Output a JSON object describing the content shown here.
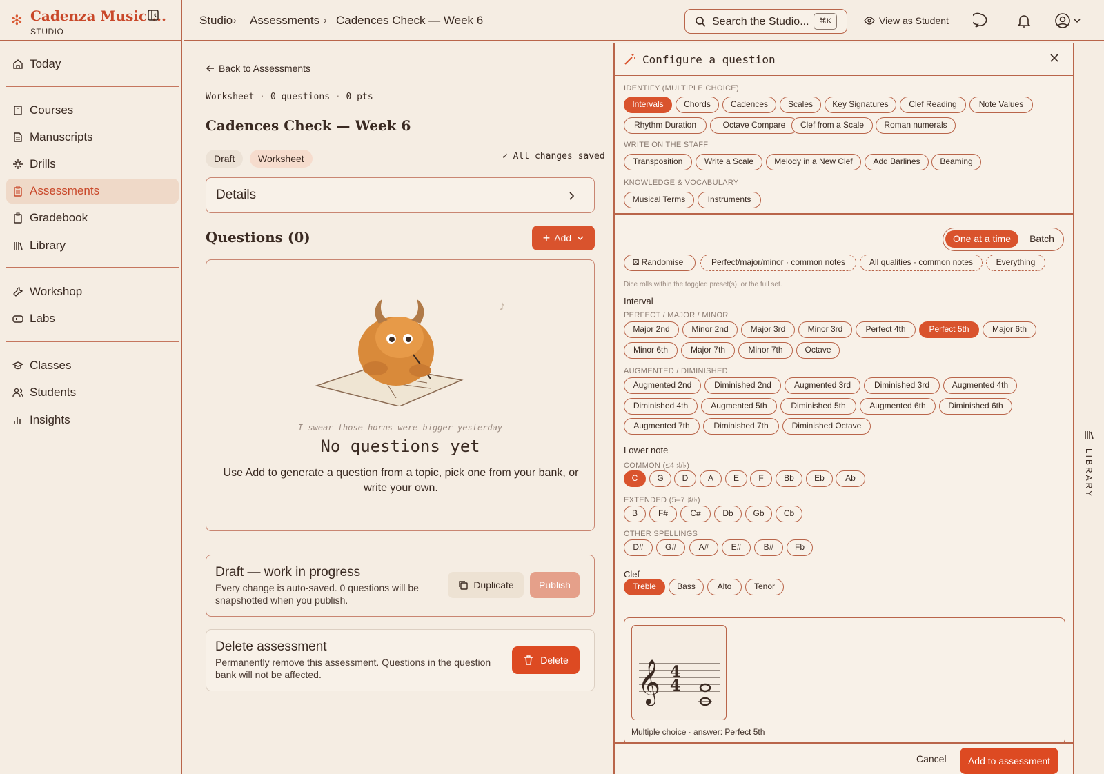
{
  "brand": {
    "name": "Cadenza Music ...",
    "sub": "STUDIO"
  },
  "nav": {
    "today": "Today",
    "courses": "Courses",
    "manuscripts": "Manuscripts",
    "drills": "Drills",
    "assessments": "Assessments",
    "gradebook": "Gradebook",
    "library": "Library",
    "workshop": "Workshop",
    "labs": "Labs",
    "classes": "Classes",
    "students": "Students",
    "insights": "Insights"
  },
  "breadcrumb": [
    "Studio",
    "Assessments",
    "Cadences Check — Week 6"
  ],
  "search": {
    "placeholder": "Search the Studio...",
    "shortcut": "⌘K"
  },
  "topbar": {
    "view_as": "View as Student"
  },
  "main": {
    "back": "Back to Assessments",
    "meta": {
      "type": "Worksheet",
      "questions": "0 questions",
      "points": "0 pts"
    },
    "title": "Cadences Check — Week 6",
    "status": {
      "draft": "Draft",
      "type": "Worksheet"
    },
    "saved": "All changes saved",
    "details": "Details",
    "questions_heading": "Questions (0)",
    "add_label": "Add",
    "empty": {
      "caption": "I swear those horns were bigger yesterday",
      "title": "No questions yet",
      "desc": "Use Add to generate a question from a topic, pick one from your bank, or write your own."
    },
    "draft": {
      "title": "Draft — work in progress",
      "desc": "Every change is auto-saved. 0 questions will be snapshotted when you publish.",
      "duplicate": "Duplicate",
      "publish": "Publish"
    },
    "delete": {
      "title": "Delete assessment",
      "desc": "Permanently remove this assessment. Questions in the question bank will not be affected.",
      "button": "Delete"
    }
  },
  "panel": {
    "title": "Configure a question",
    "identify": {
      "heading": "IDENTIFY (MULTIPLE CHOICE)",
      "items": [
        "Intervals",
        "Chords",
        "Cadences",
        "Scales",
        "Key Signatures",
        "Clef Reading",
        "Note Values",
        "Rhythm Duration",
        "Octave Compare",
        "Clef from a Scale",
        "Roman numerals"
      ],
      "selected": "Intervals"
    },
    "staff": {
      "heading": "WRITE ON THE STAFF",
      "items": [
        "Transposition",
        "Write a Scale",
        "Melody in a New Clef",
        "Add Barlines",
        "Beaming"
      ]
    },
    "knowledge": {
      "heading": "KNOWLEDGE & VOCABULARY",
      "items": [
        "Musical Terms",
        "Instruments"
      ]
    },
    "mode": {
      "one": "One at a time",
      "batch": "Batch",
      "selected": "One at a time"
    },
    "randomise": {
      "label": "Randomise",
      "presets": [
        "Perfect/major/minor · common notes",
        "All qualities · common notes",
        "Everything"
      ],
      "hint": "Dice rolls within the toggled preset(s), or the full set."
    },
    "interval": {
      "label": "Interval",
      "pmm_heading": "PERFECT / MAJOR / MINOR",
      "pmm": [
        "Major 2nd",
        "Minor 2nd",
        "Major 3rd",
        "Minor 3rd",
        "Perfect 4th",
        "Perfect 5th",
        "Major 6th",
        "Minor 6th",
        "Major 7th",
        "Minor 7th",
        "Octave"
      ],
      "ad_heading": "AUGMENTED / DIMINISHED",
      "ad": [
        "Augmented 2nd",
        "Diminished 2nd",
        "Augmented 3rd",
        "Diminished 3rd",
        "Augmented 4th",
        "Diminished 4th",
        "Augmented 5th",
        "Diminished 5th",
        "Augmented 6th",
        "Diminished 6th",
        "Augmented 7th",
        "Diminished 7th",
        "Diminished Octave"
      ],
      "selected": "Perfect 5th"
    },
    "lower_note": {
      "label": "Lower note",
      "common_heading": "COMMON (≤4 ♯/♭)",
      "common": [
        "C",
        "G",
        "D",
        "A",
        "E",
        "F",
        "Bb",
        "Eb",
        "Ab"
      ],
      "extended_heading": "EXTENDED (5–7 ♯/♭)",
      "extended": [
        "B",
        "F#",
        "C#",
        "Db",
        "Gb",
        "Cb"
      ],
      "other_heading": "OTHER SPELLINGS",
      "other": [
        "D#",
        "G#",
        "A#",
        "E#",
        "B#",
        "Fb"
      ],
      "selected": "C"
    },
    "clef": {
      "label": "Clef",
      "items": [
        "Treble",
        "Bass",
        "Alto",
        "Tenor"
      ],
      "selected": "Treble"
    },
    "preview": {
      "prefix": "Multiple choice · answer:",
      "answer": "Perfect 5th"
    },
    "footer": {
      "cancel": "Cancel",
      "add": "Add to assessment"
    }
  },
  "library_tab": "LIBRARY",
  "colors": {
    "accent": "#d9532d",
    "rule": "#b9654a",
    "background": "#f5ede3"
  }
}
